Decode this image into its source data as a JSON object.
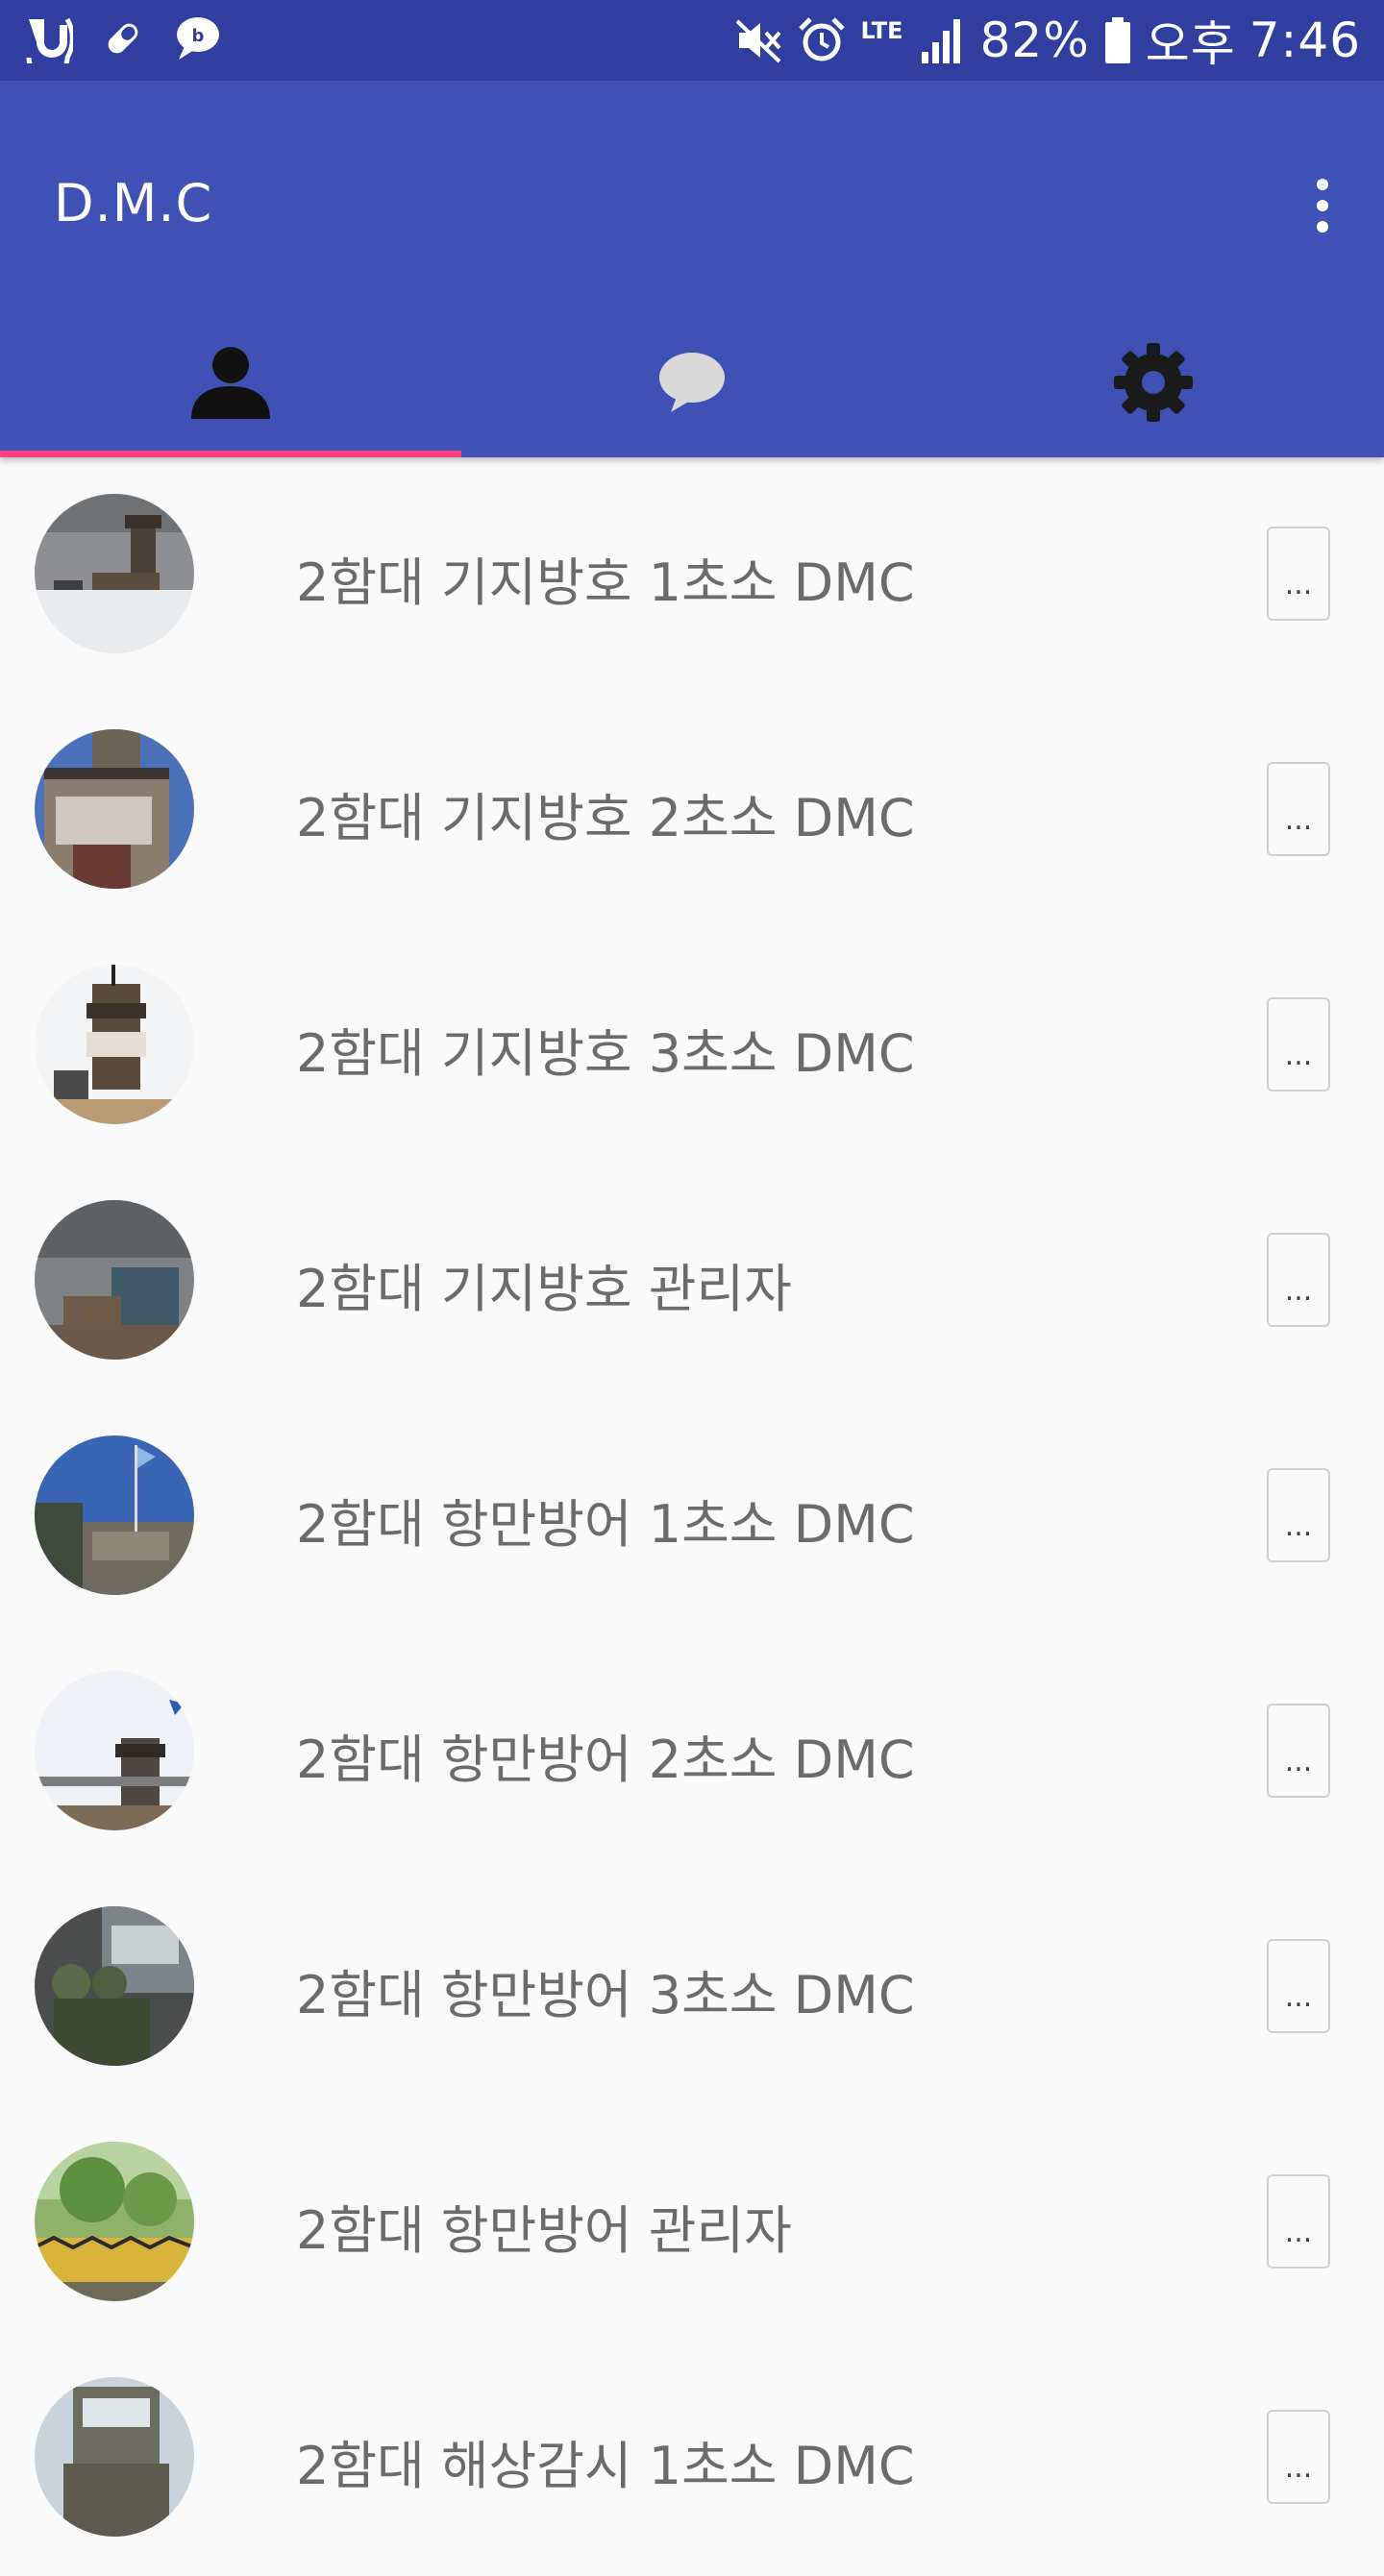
{
  "status_bar": {
    "battery": "82%",
    "ampm": "오후",
    "time": "7:46",
    "network": "LTE",
    "left_icons": [
      "u-plus-icon",
      "pill-icon",
      "chat-bubble-icon"
    ],
    "right_icons": [
      "mute-icon",
      "alarm-icon",
      "signal-icon",
      "battery-icon"
    ]
  },
  "app_bar": {
    "title": "D.M.C",
    "overflow_icon": "more-vert-icon"
  },
  "tabs": [
    {
      "icon": "person-icon",
      "selected": true
    },
    {
      "icon": "chat-bubble-icon",
      "selected": false
    },
    {
      "icon": "gear-icon",
      "selected": false
    }
  ],
  "colors": {
    "status_bar": "#303f9f",
    "primary": "#3f51b5",
    "accent": "#ff4081",
    "list_text": "#6b6b6b"
  },
  "list": {
    "items": [
      {
        "label": "2함대 기지방호 1초소 DMC",
        "more_label": "..."
      },
      {
        "label": "2함대 기지방호 2초소 DMC",
        "more_label": "..."
      },
      {
        "label": "2함대 기지방호 3초소 DMC",
        "more_label": "..."
      },
      {
        "label": "2함대 기지방호 관리자",
        "more_label": "..."
      },
      {
        "label": "2함대 항만방어 1초소 DMC",
        "more_label": "..."
      },
      {
        "label": "2함대 항만방어 2초소 DMC",
        "more_label": "..."
      },
      {
        "label": "2함대 항만방어 3초소 DMC",
        "more_label": "..."
      },
      {
        "label": "2함대 항만방어 관리자",
        "more_label": "..."
      },
      {
        "label": "2함대 해상감시 1초소 DMC",
        "more_label": "..."
      }
    ]
  }
}
